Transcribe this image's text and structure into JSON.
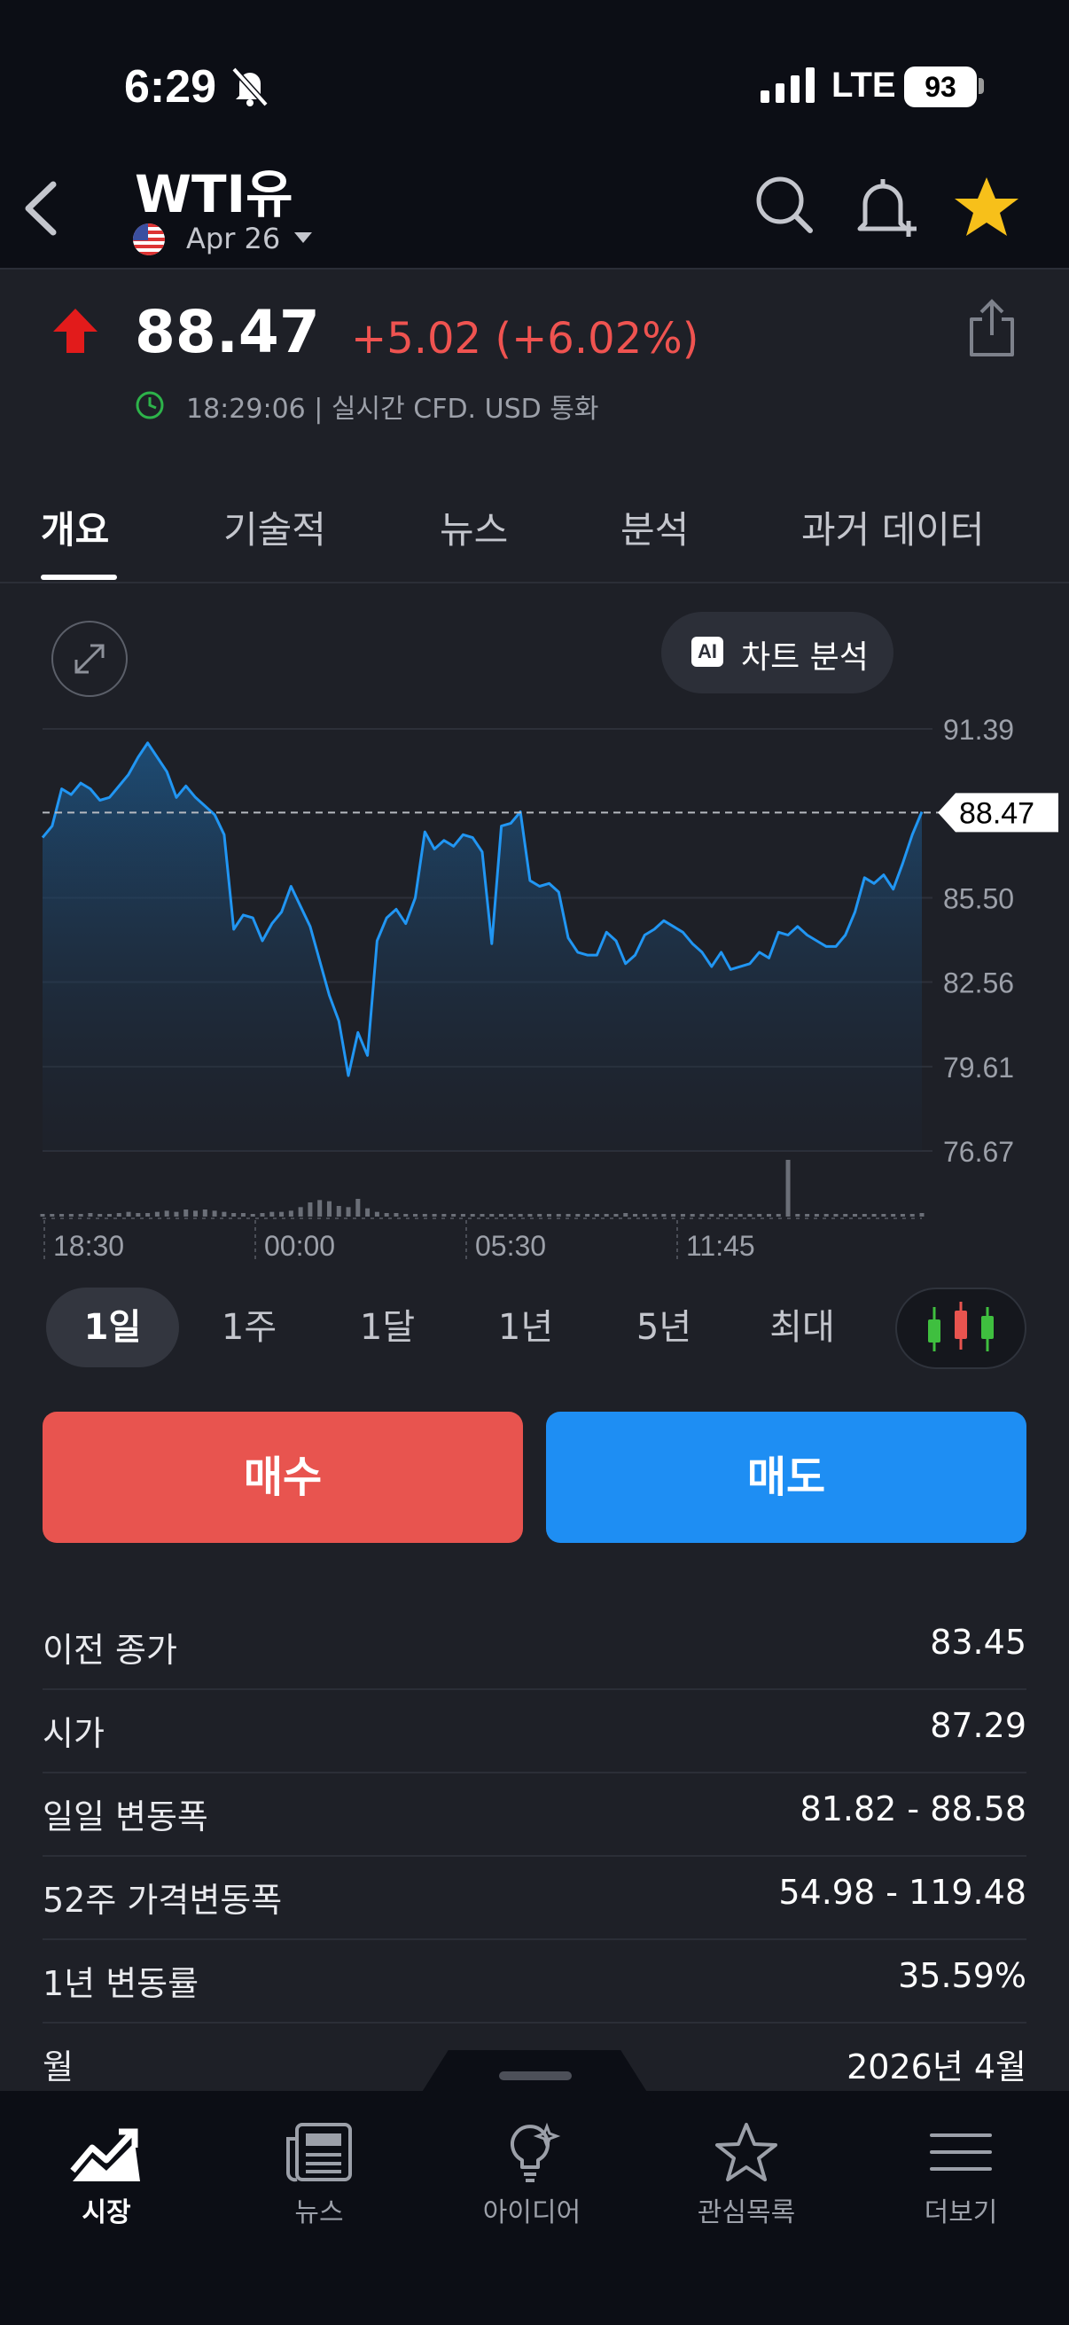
{
  "status_bar": {
    "time": "6:29",
    "network": "LTE",
    "battery": "93"
  },
  "header": {
    "title": "WTI유",
    "contract": "Apr 26"
  },
  "quote": {
    "price": "88.47",
    "change": "+5.02 (+6.02%)",
    "timestamp": "18:29:06 | 실시간 CFD. USD 통화",
    "direction_color": "#e53935"
  },
  "tabs": [
    "개요",
    "기술적",
    "뉴스",
    "분석",
    "과거 데이터"
  ],
  "ai_button": {
    "badge": "AI",
    "label": "차트 분석"
  },
  "chart_data": {
    "type": "area",
    "title": "",
    "y_ticks": [
      "91.39",
      "85.50",
      "82.56",
      "79.61",
      "76.67"
    ],
    "x_ticks": [
      "18:30",
      "00:00",
      "05:30",
      "11:45"
    ],
    "ylim": [
      76.67,
      91.39
    ],
    "current_value_label": "88.47",
    "current_value": 88.47,
    "line_color": "#2196f3",
    "series": [
      {
        "values": [
          87.6,
          88.0,
          89.3,
          89.1,
          89.5,
          89.3,
          88.9,
          89.0,
          89.4,
          89.8,
          90.4,
          90.9,
          90.4,
          89.9,
          89.0,
          89.4,
          89.0,
          88.7,
          88.4,
          87.7,
          84.4,
          84.9,
          84.8,
          84.0,
          84.6,
          85.0,
          85.9,
          85.2,
          84.5,
          83.3,
          82.1,
          81.2,
          79.3,
          80.8,
          80.0,
          84.0,
          84.8,
          85.1,
          84.6,
          85.5,
          87.8,
          87.2,
          87.5,
          87.3,
          87.7,
          87.6,
          87.1,
          83.9,
          88.0,
          88.1,
          88.5,
          86.1,
          85.9,
          86.0,
          85.7,
          84.1,
          83.6,
          83.5,
          83.5,
          84.3,
          84.0,
          83.2,
          83.5,
          84.2,
          84.4,
          84.7,
          84.5,
          84.3,
          83.9,
          83.6,
          83.1,
          83.6,
          83.0,
          83.1,
          83.2,
          83.6,
          83.4,
          84.3,
          84.2,
          84.5,
          84.2,
          84.0,
          83.8,
          83.8,
          84.2,
          85.0,
          86.2,
          86.0,
          86.3,
          85.8,
          86.7,
          87.7,
          88.5
        ]
      }
    ],
    "volume": [
      2,
      2,
      1,
      1,
      2,
      3,
      2,
      2,
      3,
      4,
      3,
      3,
      4,
      5,
      4,
      6,
      5,
      6,
      5,
      4,
      3,
      3,
      2,
      3,
      4,
      4,
      5,
      8,
      12,
      14,
      13,
      9,
      8,
      15,
      7,
      4,
      3,
      3,
      2,
      2,
      1,
      1,
      1,
      0,
      1,
      1,
      1,
      1,
      0,
      0,
      0,
      0,
      0,
      0,
      0,
      0,
      0,
      0,
      0,
      0,
      0,
      3,
      2,
      1,
      1,
      1,
      1,
      1,
      0,
      1,
      1,
      0,
      0,
      1,
      0,
      0,
      0,
      0,
      48,
      0,
      0,
      0,
      0,
      0,
      0,
      0,
      1,
      1,
      1,
      2,
      1,
      2,
      3
    ]
  },
  "periods": [
    "1일",
    "1주",
    "1달",
    "1년",
    "5년",
    "최대"
  ],
  "actions": {
    "buy": "매수",
    "sell": "매도",
    "buy_color": "#e8544f",
    "sell_color": "#1e8ef3"
  },
  "stats": [
    {
      "label": "이전 종가",
      "value": "83.45"
    },
    {
      "label": "시가",
      "value": "87.29"
    },
    {
      "label": "일일 변동폭",
      "value": "81.82 - 88.58"
    },
    {
      "label": "52주 가격변동폭",
      "value": "54.98 - 119.48"
    },
    {
      "label": "1년 변동률",
      "value": "35.59%"
    },
    {
      "label": "월",
      "value": "2026년 4월"
    }
  ],
  "bottom_nav": [
    {
      "label": "시장",
      "icon": "market-chart-icon"
    },
    {
      "label": "뉴스",
      "icon": "newspaper-icon"
    },
    {
      "label": "아이디어",
      "icon": "lightbulb-icon"
    },
    {
      "label": "관심목록",
      "icon": "star-outline-icon"
    },
    {
      "label": "더보기",
      "icon": "menu-icon"
    }
  ]
}
